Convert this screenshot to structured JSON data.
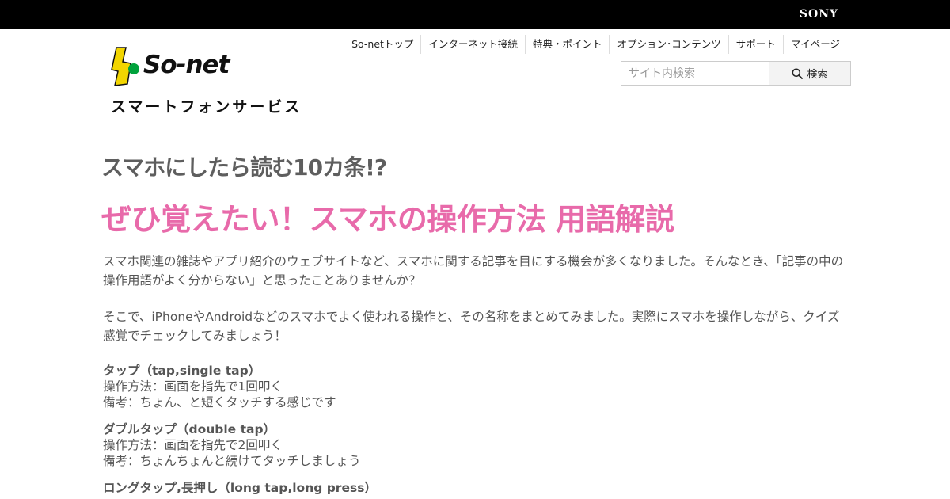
{
  "header": {
    "brand": "SONY",
    "logo_text": "So-net",
    "service_title": "スマートフォンサービス"
  },
  "nav": {
    "items": [
      {
        "label": "So-netトップ"
      },
      {
        "label": "インターネット接続"
      },
      {
        "label": "特典・ポイント"
      },
      {
        "label": "オプション･コンテンツ"
      },
      {
        "label": "サポート"
      },
      {
        "label": "マイページ"
      }
    ]
  },
  "search": {
    "placeholder": "サイト内検索",
    "button_label": "検索"
  },
  "article": {
    "category": "スマホにしたら読む10カ条!?",
    "title": "ぜひ覚えたい！スマホの操作方法 用語解説",
    "paragraphs": [
      "スマホ関連の雑誌やアプリ紹介のウェブサイトなど、スマホに関する記事を目にする機会が多くなりました。そんなとき、「記事の中の操作用語がよく分からない」と思ったことありませんか？",
      "そこで、iPhoneやAndroidなどのスマホでよく使われる操作と、その名称をまとめてみました。実際にスマホを操作しながら、クイズ感覚でチェックしてみましょう！"
    ],
    "terms": [
      {
        "name": "タップ（tap,single tap）",
        "method": "操作方法：画面を指先で1回叩く",
        "note": "備考：ちょん、と短くタッチする感じです"
      },
      {
        "name": "ダブルタップ（double tap）",
        "method": "操作方法：画面を指先で2回叩く",
        "note": "備考：ちょんちょんと続けてタッチしましょう"
      },
      {
        "name": "ロングタップ,長押し（long tap,long press）"
      }
    ]
  },
  "colors": {
    "title_pink": "#e86aaa",
    "logo_yellow": "#f2d500",
    "logo_green": "#00a23c"
  }
}
